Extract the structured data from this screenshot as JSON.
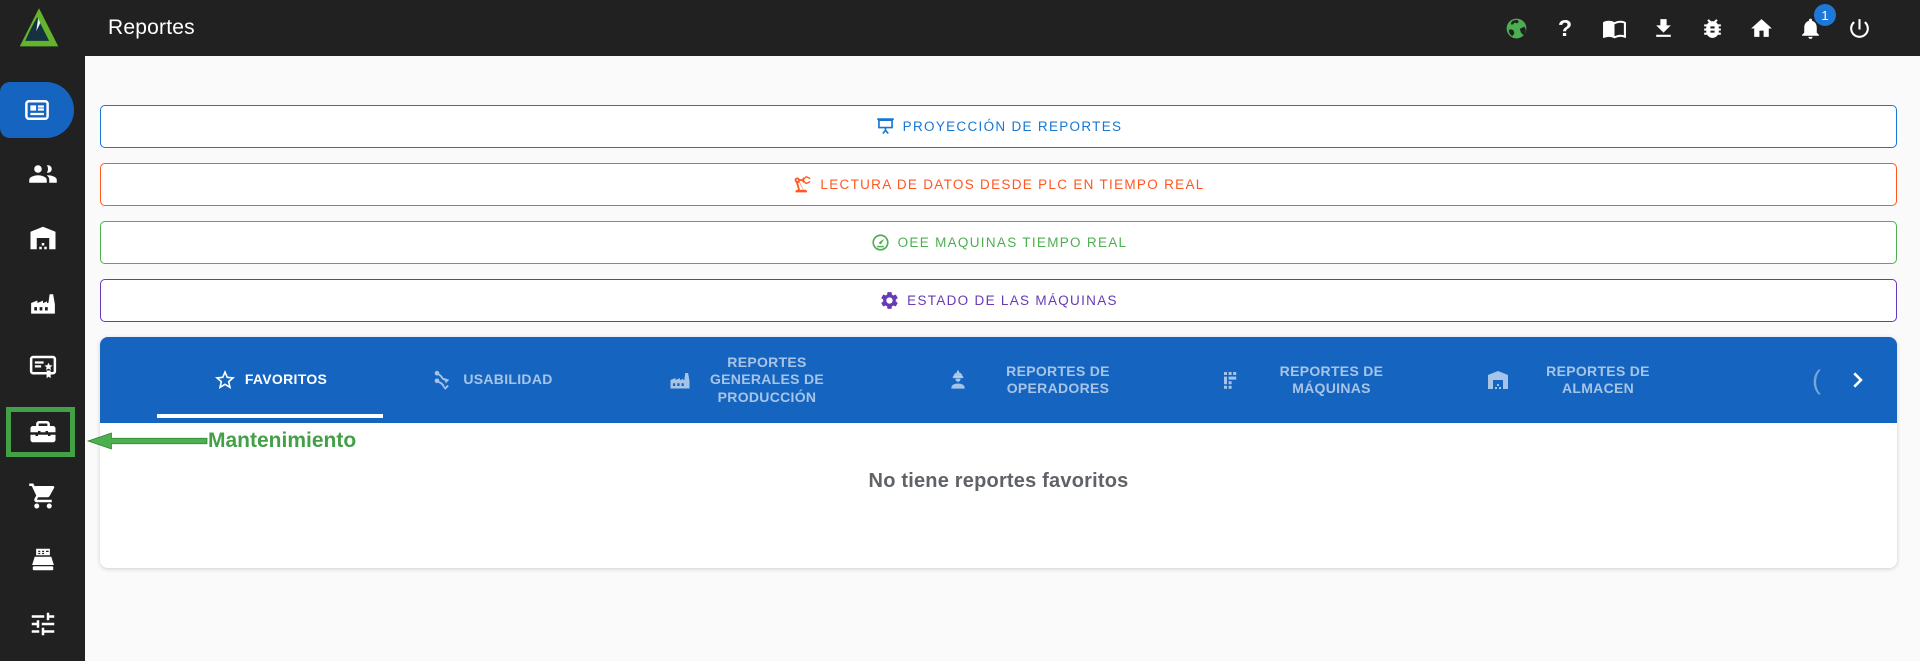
{
  "header": {
    "title": "Reportes",
    "help_glyph": "?",
    "notification_badge": "1",
    "badge_color": "#1E78D7",
    "bar_color": "#212121",
    "icons": [
      "globe-icon",
      "help-icon",
      "manual-book-icon",
      "download-icon",
      "bug-report-icon",
      "home-icon",
      "notifications-icon",
      "power-icon"
    ]
  },
  "sidebar": {
    "active_color": "#1565C0",
    "highlight_color": "#43A047",
    "items": [
      {
        "icon": "reports-icon",
        "active": true
      },
      {
        "icon": "users-icon"
      },
      {
        "icon": "warehouse-icon"
      },
      {
        "icon": "factory-icon"
      },
      {
        "icon": "certificate-icon"
      },
      {
        "icon": "maintenance-toolbox-icon",
        "highlighted": true
      },
      {
        "icon": "shopping-cart-icon"
      },
      {
        "icon": "cash-register-icon"
      },
      {
        "icon": "tune-icon"
      }
    ]
  },
  "quick_actions": [
    {
      "label": "PROYECCIÓN DE REPORTES",
      "color": "#1976D2",
      "icon": "projector-screen-icon"
    },
    {
      "label": "LECTURA DE DATOS DESDE PLC EN TIEMPO REAL",
      "color": "#FF5722",
      "icon": "robot-arm-icon"
    },
    {
      "label": "OEE MAQUINAS TIEMPO REAL",
      "color": "#4CAF50",
      "icon": "gauge-icon"
    },
    {
      "label": "ESTADO DE LAS MÁQUINAS",
      "color": "#673AB7",
      "icon": "gear-icon"
    }
  ],
  "tabs": {
    "bar_color": "#1565C0",
    "items": [
      {
        "label": "FAVORITOS",
        "icon": "star-icon",
        "active": true
      },
      {
        "label": "USABILIDAD",
        "icon": "usability-icon",
        "active": false
      },
      {
        "label": "REPORTES GENERALES DE PRODUCCIÓN",
        "icon": "factory-icon",
        "active": false
      },
      {
        "label": "REPORTES DE OPERADORES",
        "icon": "operator-icon",
        "active": false
      },
      {
        "label": "REPORTES DE MÁQUINAS",
        "icon": "machines-icon",
        "active": false
      },
      {
        "label": "REPORTES DE ALMACEN",
        "icon": "warehouse-icon",
        "active": false
      }
    ],
    "paginator": {
      "left": "(",
      "right_icon": "chevron-right-icon"
    }
  },
  "favorites_panel": {
    "empty_message": "No tiene reportes favoritos"
  },
  "annotation": {
    "label": "Mantenimiento",
    "color": "#43A047"
  }
}
